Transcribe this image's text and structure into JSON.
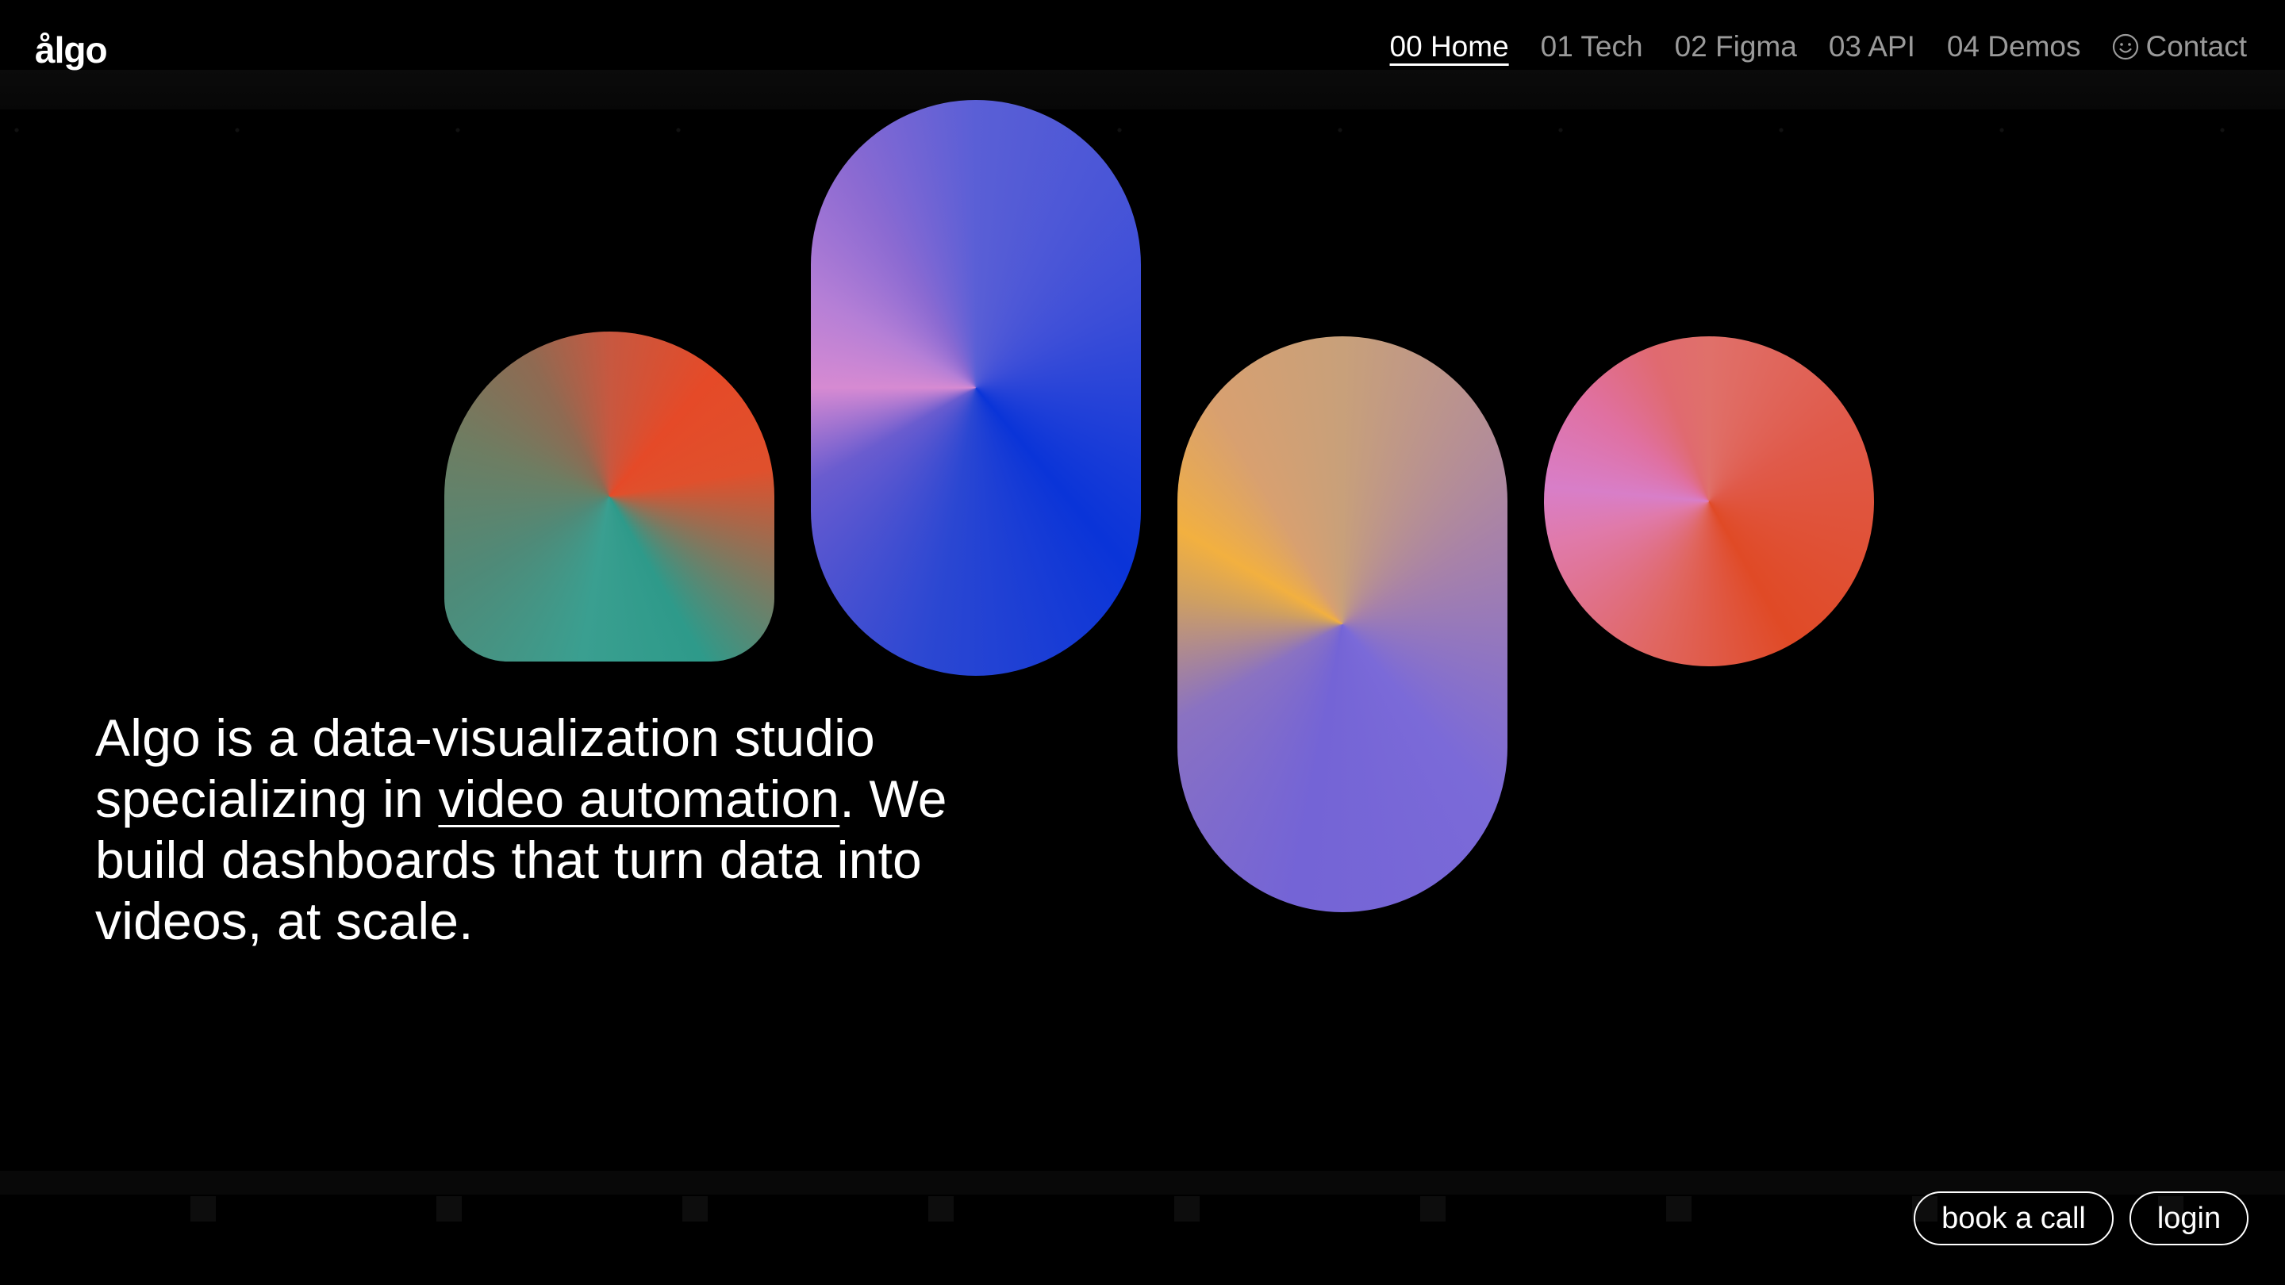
{
  "logo": {
    "text": "ålgo"
  },
  "nav": {
    "items": [
      {
        "label": "00 Home",
        "active": true
      },
      {
        "label": "01 Tech",
        "active": false
      },
      {
        "label": "02 Figma",
        "active": false
      },
      {
        "label": "03 API",
        "active": false
      },
      {
        "label": "04 Demos",
        "active": false
      }
    ],
    "contact": {
      "label": "Contact",
      "icon": "smile-icon"
    }
  },
  "hero": {
    "line_before_link": "Algo is a data-visualization studio specializing in ",
    "link_text": "video automation",
    "line_after_link": ". We build dashboards that turn data into videos, at scale."
  },
  "actions": {
    "book_call_label": "book a call",
    "login_label": "login"
  },
  "colors": {
    "background": "#000000",
    "text": "#ffffff",
    "nav_inactive": "#9a9a9a"
  }
}
